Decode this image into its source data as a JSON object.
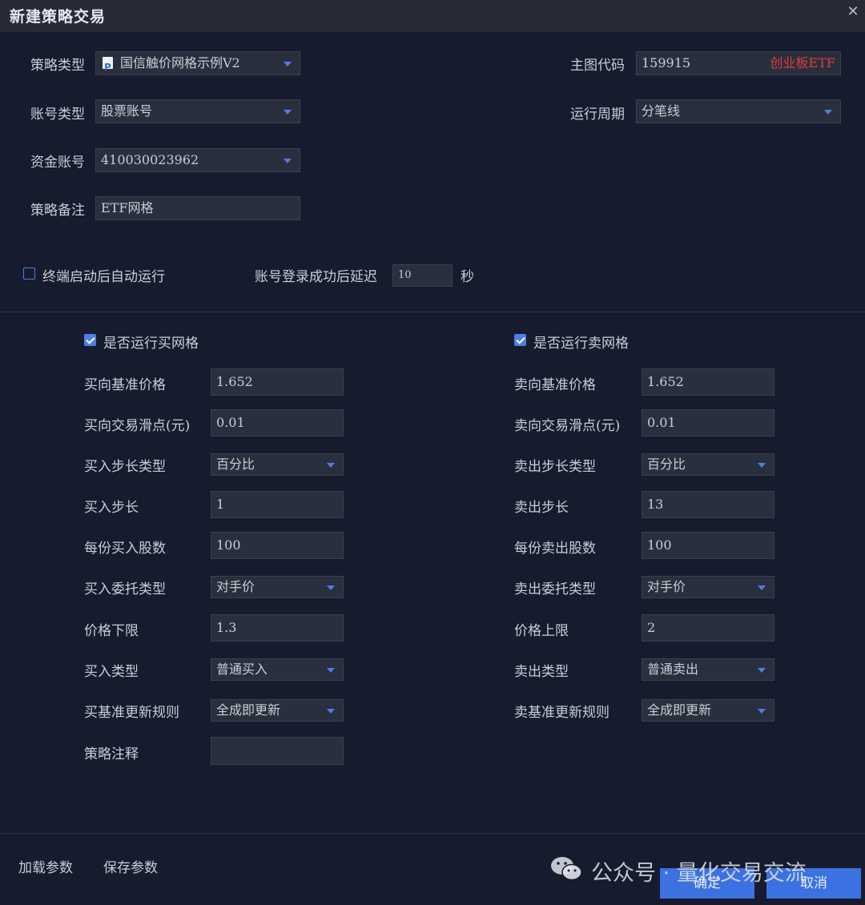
{
  "window": {
    "title": "新建策略交易"
  },
  "top": {
    "strategy_type": {
      "label": "策略类型",
      "value": "国信触价网格示例V2"
    },
    "account_type": {
      "label": "账号类型",
      "value": "股票账号"
    },
    "fund_account": {
      "label": "资金账号",
      "value": "410030023962"
    },
    "note": {
      "label": "策略备注",
      "value": "ETF网格"
    },
    "main_code": {
      "label": "主图代码",
      "value": "159915",
      "name": "创业板ETF"
    },
    "period": {
      "label": "运行周期",
      "value": "分笔线"
    },
    "auto_run": {
      "label": "终端启动后自动运行",
      "checked": false
    },
    "delay": {
      "label": "账号登录成功后延迟",
      "value": "10",
      "unit": "秒"
    }
  },
  "buy": {
    "enable_label": "是否运行买网格",
    "base_price": {
      "label": "买向基准价格",
      "value": "1.652"
    },
    "slippage": {
      "label": "买向交易滑点(元)",
      "value": "0.01"
    },
    "step_type": {
      "label": "买入步长类型",
      "value": "百分比"
    },
    "step": {
      "label": "买入步长",
      "value": "1"
    },
    "shares": {
      "label": "每份买入股数",
      "value": "100"
    },
    "order_type": {
      "label": "买入委托类型",
      "value": "对手价"
    },
    "price_limit": {
      "label": "价格下限",
      "value": "1.3"
    },
    "trade_type": {
      "label": "买入类型",
      "value": "普通买入"
    },
    "update_rule": {
      "label": "买基准更新规则",
      "value": "全成即更新"
    },
    "comment": {
      "label": "策略注释",
      "value": ""
    }
  },
  "sell": {
    "enable_label": "是否运行卖网格",
    "base_price": {
      "label": "卖向基准价格",
      "value": "1.652"
    },
    "slippage": {
      "label": "卖向交易滑点(元)",
      "value": "0.01"
    },
    "step_type": {
      "label": "卖出步长类型",
      "value": "百分比"
    },
    "step": {
      "label": "卖出步长",
      "value": "13"
    },
    "shares": {
      "label": "每份卖出股数",
      "value": "100"
    },
    "order_type": {
      "label": "卖出委托类型",
      "value": "对手价"
    },
    "price_limit": {
      "label": "价格上限",
      "value": "2"
    },
    "trade_type": {
      "label": "卖出类型",
      "value": "普通卖出"
    },
    "update_rule": {
      "label": "卖基准更新规则",
      "value": "全成即更新"
    }
  },
  "footer": {
    "load_label": "加载参数",
    "save_label": "保存参数",
    "ok_label": "确定",
    "cancel_label": "取消",
    "watermark": "公众号 · 量化交易交流"
  },
  "colors": {
    "accent": "#3b71e0",
    "background": "#161b2e",
    "field": "#2a2f3d",
    "red": "#e33b3b"
  },
  "icons": [
    "close-icon",
    "strategy-file-icon",
    "dropdown-caret-icon",
    "checkbox-icon",
    "wechat-icon"
  ]
}
